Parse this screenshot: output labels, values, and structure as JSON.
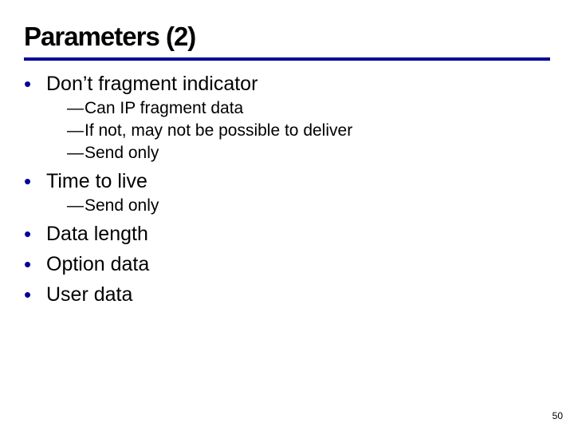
{
  "slide": {
    "title": "Parameters (2)",
    "bullets": {
      "b1_0": "Don’t fragment indicator",
      "b1_0_sub": {
        "s0": "Can IP fragment data",
        "s1": "If not, may not be possible to deliver",
        "s2": "Send only"
      },
      "b1_1": "Time to live",
      "b1_1_sub": {
        "s0": "Send only"
      },
      "b1_2": "Data length",
      "b1_3": "Option data",
      "b1_4": "User data"
    },
    "page_number": "50"
  }
}
